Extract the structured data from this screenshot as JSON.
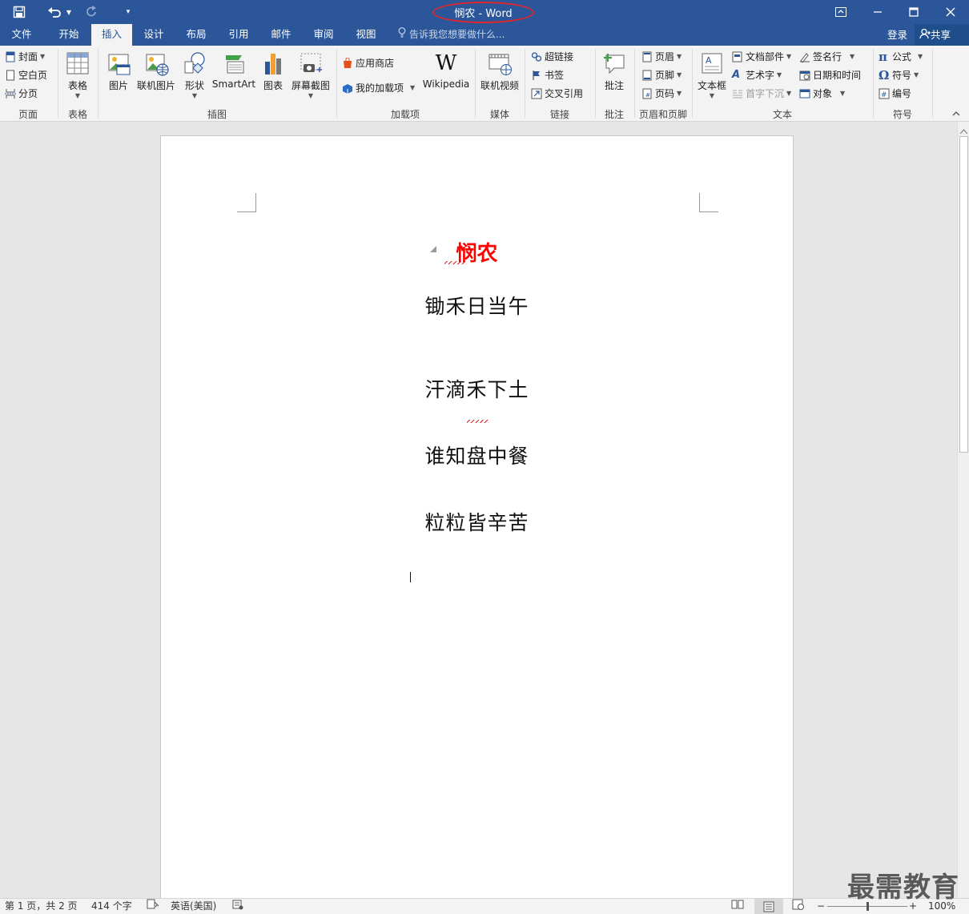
{
  "titlebar": {
    "title": "悯农 - Word",
    "quick_access": [
      "save-icon",
      "undo-icon",
      "redo-icon",
      "customize-icon"
    ],
    "window_controls": [
      "ribbon-display-icon",
      "minimize-icon",
      "maximize-icon",
      "close-icon"
    ]
  },
  "tabs": [
    {
      "label": "文件"
    },
    {
      "label": "开始"
    },
    {
      "label": "插入"
    },
    {
      "label": "设计"
    },
    {
      "label": "布局"
    },
    {
      "label": "引用"
    },
    {
      "label": "邮件"
    },
    {
      "label": "审阅"
    },
    {
      "label": "视图"
    }
  ],
  "active_tab": "插入",
  "tell_me": "告诉我您想要做什么...",
  "signin": "登录",
  "share": "共享",
  "ribbon": {
    "groups": {
      "pages": "页面",
      "tables": "表格",
      "illustrations": "插图",
      "addins": "加载项",
      "media": "媒体",
      "links": "链接",
      "comments": "批注",
      "header_footer": "页眉和页脚",
      "text": "文本",
      "symbols": "符号"
    },
    "pages": {
      "cover": "封面",
      "blank": "空白页",
      "break": "分页"
    },
    "table": "表格",
    "illustrations": {
      "pictures": "图片",
      "online_pictures": "联机图片",
      "shapes": "形状",
      "smartart": "SmartArt",
      "chart": "图表",
      "screenshot": "屏幕截图"
    },
    "addins": {
      "store": "应用商店",
      "my_addins": "我的加载项",
      "wikipedia": "Wikipedia"
    },
    "media": {
      "online_video": "联机视频"
    },
    "links": {
      "hyperlink": "超链接",
      "bookmark": "书签",
      "cross_ref": "交叉引用"
    },
    "comment": "批注",
    "header_footer": {
      "header": "页眉",
      "footer": "页脚",
      "page_number": "页码"
    },
    "text": {
      "textbox": "文本框",
      "quick_parts": "文档部件",
      "wordart": "艺术字",
      "dropcap": "首字下沉",
      "signature": "签名行",
      "datetime": "日期和时间",
      "object": "对象"
    },
    "symbols": {
      "equation": "公式",
      "symbol": "符号",
      "number": "编号"
    }
  },
  "document": {
    "title": "悯农",
    "lines": [
      "锄禾日当午",
      "汗滴禾下土",
      "谁知盘中餐",
      "粒粒皆辛苦"
    ]
  },
  "status": {
    "page": "第 1 页，共 2 页",
    "words": "414 个字",
    "language": "英语(美国)",
    "zoom": "100%",
    "zoom_fraction": 0.5
  },
  "watermark": "最需教育",
  "colors": {
    "accent": "#2b579a",
    "title_red": "#ff0000",
    "annotation_red": "#e0262b"
  }
}
